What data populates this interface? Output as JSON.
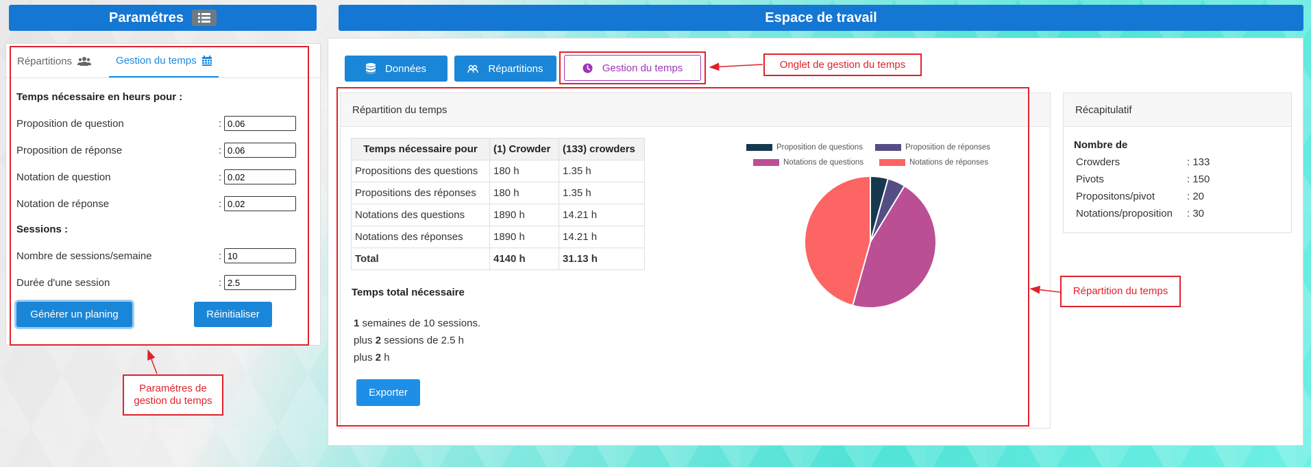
{
  "left_header": {
    "title": "Paramétres",
    "icon": "list-icon"
  },
  "workspace_header": {
    "title": "Espace de travail"
  },
  "left_tabs": [
    {
      "label": "Répartitions",
      "icon": "users-icon"
    },
    {
      "label": "Gestion du temps",
      "icon": "calendar-icon"
    }
  ],
  "form": {
    "section_time": "Temps nécessaire en heurs pour :",
    "fields_time": [
      {
        "label": "Proposition de question",
        "value": "0.06"
      },
      {
        "label": "Proposition de réponse",
        "value": "0.06"
      },
      {
        "label": "Notation de question",
        "value": "0.02"
      },
      {
        "label": "Notation de réponse",
        "value": "0.02"
      }
    ],
    "section_sessions": "Sessions :",
    "fields_sessions": [
      {
        "label": "Nombre de sessions/semaine",
        "value": "10"
      },
      {
        "label": "Durée d'une session",
        "value": "2.5"
      }
    ],
    "colon": ":",
    "generate_label": "Générer un planing",
    "reset_label": "Réinitialiser"
  },
  "workspace_tabs": [
    {
      "label": "Données",
      "icon": "database-icon"
    },
    {
      "label": "Répartitions",
      "icon": "users-icon"
    },
    {
      "label": "Gestion du temps",
      "icon": "clock-icon"
    }
  ],
  "repartition": {
    "title": "Répartition du temps",
    "table_headers": [
      "Temps nécessaire pour",
      "(1) Crowder",
      "(133) crowders"
    ],
    "table_rows": [
      [
        "Propositions des questions",
        "180 h",
        "1.35 h"
      ],
      [
        "Propositions des réponses",
        "180 h",
        "1.35 h"
      ],
      [
        "Notations des questions",
        "1890 h",
        "14.21 h"
      ],
      [
        "Notations des réponses",
        "1890 h",
        "14.21 h"
      ]
    ],
    "table_total": [
      "Total",
      "4140 h",
      "31.13 h"
    ],
    "total_title": "Temps total nécessaire",
    "summary": [
      {
        "num": "1",
        "text": " semaines de 10 sessions."
      },
      {
        "prefix": "plus ",
        "num": "2",
        "text": " sessions de 2.5 h"
      },
      {
        "prefix": "plus ",
        "num": "2",
        "text": " h"
      }
    ],
    "export_label": "Exporter"
  },
  "chart_data": {
    "type": "pie",
    "labels": [
      "Proposition de questions",
      "Proposition de réponses",
      "Notations de questions",
      "Notations de réponses"
    ],
    "values": [
      180,
      180,
      1890,
      1890
    ],
    "colors": [
      "#16394f",
      "#554d85",
      "#bb4f94",
      "#fd6464"
    ],
    "legend_position": "top"
  },
  "recap": {
    "title": "Récapitulatif",
    "subtitle": "Nombre de",
    "rows": [
      {
        "key": "Crowders",
        "value": ": 133"
      },
      {
        "key": "Pivots",
        "value": ": 150"
      },
      {
        "key": "Propositons/pivot",
        "value": ": 20"
      },
      {
        "key": "Notations/proposition",
        "value": ": 30"
      }
    ]
  },
  "annotations": {
    "onglet": "Onglet de gestion du temps",
    "repartition": "Répartition du temps",
    "parametres_line1": "Paramétres de",
    "parametres_line2": "gestion du temps"
  },
  "colors": {
    "primary": "#1477d4",
    "button": "#1a86d8",
    "annotation": "#e0212b",
    "active_tab": "#a034b8"
  }
}
